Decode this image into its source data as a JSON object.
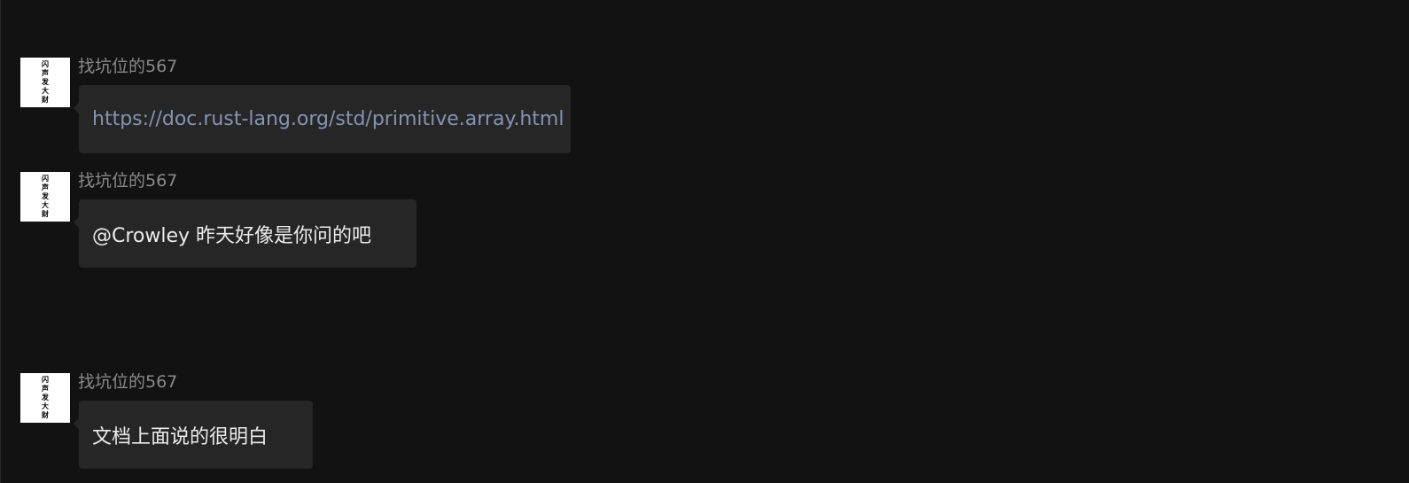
{
  "messages": [
    {
      "avatar_text": "闪声发大财",
      "sender": "找坑位的567",
      "text": "https://doc.rust-lang.org/std/primitive.array.html",
      "is_link": true
    },
    {
      "avatar_text": "闪声发大财",
      "sender": "找坑位的567",
      "text": "@Crowley 昨天好像是你问的吧",
      "is_link": false
    },
    {
      "avatar_text": "闪声发大财",
      "sender": "找坑位的567",
      "text": "文档上面说的很明白",
      "is_link": false
    }
  ],
  "colors": {
    "background": "#121212",
    "bubble": "#262626",
    "sender": "#8a8a8a",
    "text": "#ececec",
    "link": "#8593b3"
  }
}
